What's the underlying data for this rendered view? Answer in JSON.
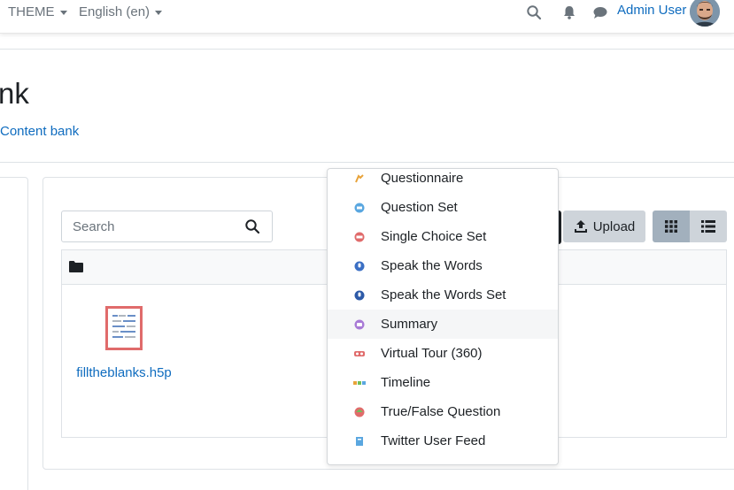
{
  "navbar": {
    "theme_label": "THEME",
    "language_label": "English (en)",
    "user_name": "Admin User"
  },
  "page": {
    "title": "nk",
    "breadcrumb": "Content bank"
  },
  "toolbar": {
    "search_placeholder": "Search",
    "upload_label": "Upload"
  },
  "files": [
    {
      "name": "filltheblanks.h5p"
    }
  ],
  "dropdown": {
    "items": [
      {
        "label": "Questionnaire",
        "icon": "questionnaire-icon"
      },
      {
        "label": "Question Set",
        "icon": "question-set-icon"
      },
      {
        "label": "Single Choice Set",
        "icon": "single-choice-set-icon"
      },
      {
        "label": "Speak the Words",
        "icon": "speak-the-words-icon"
      },
      {
        "label": "Speak the Words Set",
        "icon": "speak-the-words-set-icon"
      },
      {
        "label": "Summary",
        "icon": "summary-icon",
        "active": true
      },
      {
        "label": "Virtual Tour (360)",
        "icon": "virtual-tour-icon"
      },
      {
        "label": "Timeline",
        "icon": "timeline-icon"
      },
      {
        "label": "True/False Question",
        "icon": "true-false-question-icon"
      },
      {
        "label": "Twitter User Feed",
        "icon": "twitter-user-feed-icon"
      }
    ]
  },
  "colors": {
    "link": "#0f6cbf",
    "text": "#1d2125",
    "muted": "#6a737b",
    "button_secondary": "#ced4da",
    "button_active": "#a2b0bd",
    "thumb_red": "#e06b6b"
  }
}
